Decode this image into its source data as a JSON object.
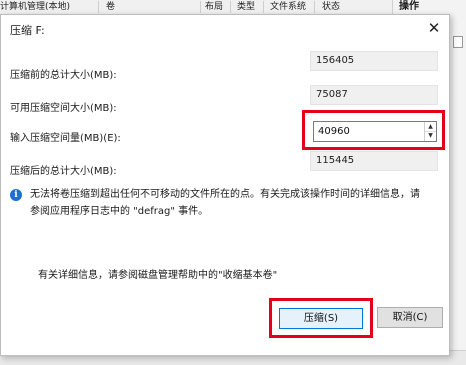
{
  "background": {
    "columns": [
      "计算机管理(本地)",
      "卷",
      "布局",
      "类型",
      "文件系统",
      "状态"
    ],
    "operations_label": "操作"
  },
  "dialog": {
    "title": "压缩 F:",
    "rows": [
      {
        "label": "压缩前的总计大小(MB):",
        "value": "156405"
      },
      {
        "label": "可用压缩空间大小(MB):",
        "value": "75087"
      },
      {
        "label": "输入压缩空间量(MB)(E):",
        "value": "40960"
      },
      {
        "label": "压缩后的总计大小(MB):",
        "value": "115445"
      }
    ],
    "info_line1": "无法将卷压缩到超出任何不可移动的文件所在的点。有关完成该操作时间的详细信息，请",
    "info_line2": "参阅应用程序日志中的 \"defrag\" 事件。",
    "help_text": "有关详细信息，请参阅磁盘管理帮助中的\"收缩基本卷\"",
    "buttons": {
      "shrink": "压缩(S)",
      "cancel": "取消(C)"
    }
  },
  "colors": {
    "highlight": "#e2001a",
    "info_icon": "#1e6fd0",
    "primary_border": "#0078d7"
  }
}
